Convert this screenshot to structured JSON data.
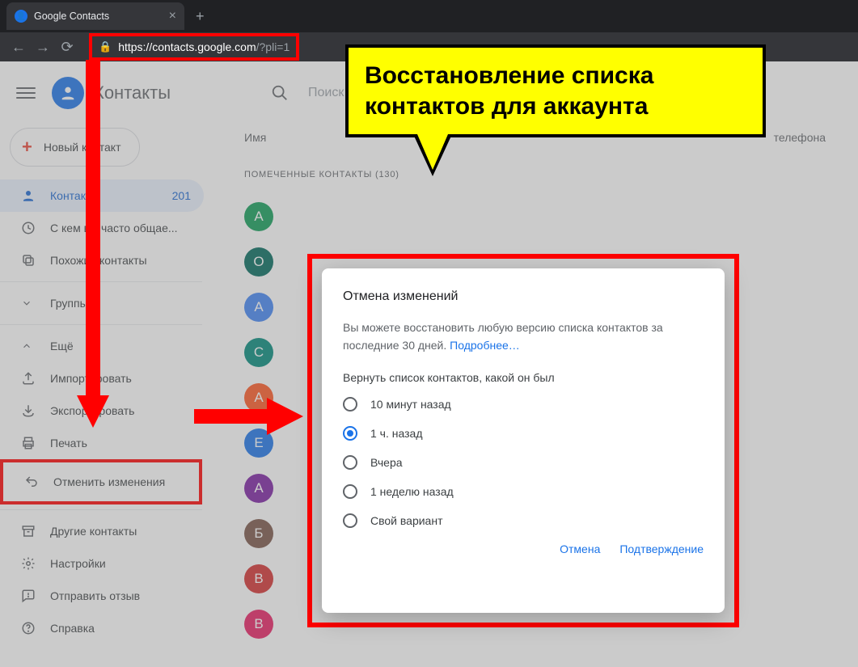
{
  "browser": {
    "tab_title": "Google Contacts",
    "url_host": "https://contacts.google.com",
    "url_path": "/?pli=1"
  },
  "callout": {
    "text": "Восстановление списка контактов для аккаунта"
  },
  "app": {
    "title": "Контакты",
    "search_placeholder": "Поиск"
  },
  "sidebar": {
    "new_contact": "Новый контакт",
    "items": [
      {
        "label": "Контакты",
        "badge": "201"
      },
      {
        "label": "С кем вы часто общае..."
      },
      {
        "label": "Похожие контакты"
      }
    ],
    "groups_label": "Группы",
    "more_label": "Ещё",
    "more": [
      {
        "label": "Импортировать"
      },
      {
        "label": "Экспортировать"
      },
      {
        "label": "Печать"
      },
      {
        "label": "Отменить изменения"
      }
    ],
    "bottom": [
      {
        "label": "Другие контакты"
      },
      {
        "label": "Настройки"
      },
      {
        "label": "Отправить отзыв"
      },
      {
        "label": "Справка"
      }
    ]
  },
  "content": {
    "col_name": "Имя",
    "col_phone": "телефона",
    "section_header": "ПОМЕЧЕННЫЕ КОНТАКТЫ (130)",
    "avatars": [
      {
        "letter": "А",
        "cls": "c-green"
      },
      {
        "letter": "О",
        "cls": "c-darkgreen"
      },
      {
        "letter": "А",
        "cls": "c-lblue"
      },
      {
        "letter": "С",
        "cls": "c-cyan"
      },
      {
        "letter": "А",
        "cls": "c-orange"
      },
      {
        "letter": "Е",
        "cls": "c-blue"
      },
      {
        "letter": "А",
        "cls": "c-purple"
      },
      {
        "letter": "Б",
        "cls": "c-brown"
      },
      {
        "letter": "В",
        "cls": "c-red"
      },
      {
        "letter": "В",
        "cls": "c-pink"
      }
    ]
  },
  "dialog": {
    "title": "Отмена изменений",
    "desc_pre": "Вы можете восстановить любую версию списка контактов за последние 30 дней. ",
    "desc_link": "Подробнее…",
    "restore_label": "Вернуть список контактов, какой он был",
    "options": [
      "10 минут назад",
      "1 ч. назад",
      "Вчера",
      "1 неделю назад",
      "Свой вариант"
    ],
    "selected_index": 1,
    "cancel": "Отмена",
    "confirm": "Подтверждение"
  }
}
